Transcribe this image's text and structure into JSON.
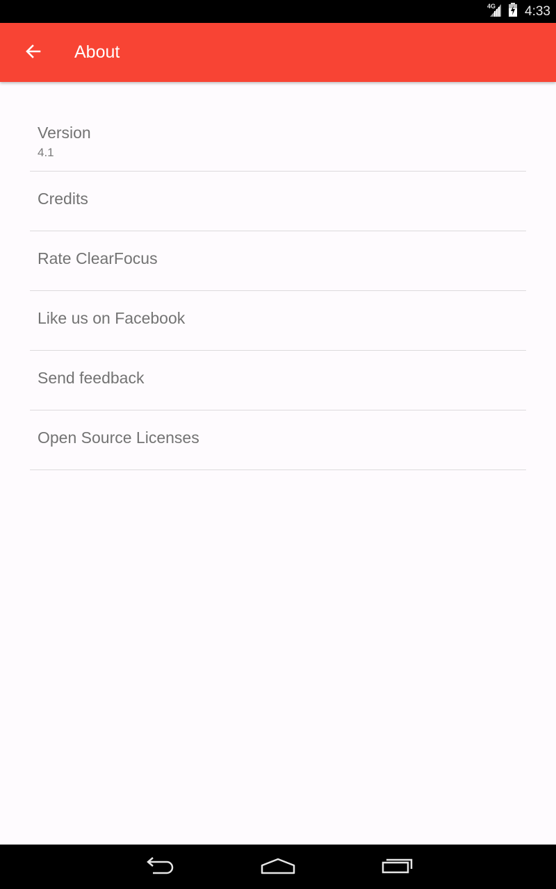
{
  "status_bar": {
    "network": "4G",
    "time": "4:33"
  },
  "toolbar": {
    "title": "About",
    "back_icon": "arrow-left-icon",
    "color": "#f84434"
  },
  "items": [
    {
      "title": "Version",
      "subtitle": "4.1"
    },
    {
      "title": "Credits"
    },
    {
      "title": "Rate ClearFocus"
    },
    {
      "title": "Like us on Facebook"
    },
    {
      "title": "Send feedback"
    },
    {
      "title": "Open Source Licenses"
    }
  ],
  "nav_bar": {
    "back": "back-icon",
    "home": "home-icon",
    "recents": "recents-icon"
  }
}
